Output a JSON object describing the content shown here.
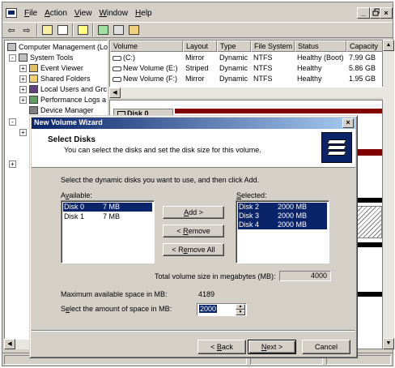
{
  "menu": {
    "items": [
      "File",
      "Action",
      "View",
      "Window",
      "Help"
    ],
    "accel": [
      "F",
      "A",
      "V",
      "W",
      "H"
    ]
  },
  "window_controls": [
    "_",
    "×"
  ],
  "tree": {
    "items": [
      {
        "label": "Computer Management (Lo",
        "expander": ""
      },
      {
        "label": "System Tools",
        "expander": "-"
      },
      {
        "label": "Event Viewer",
        "expander": "+"
      },
      {
        "label": "Shared Folders",
        "expander": "+"
      },
      {
        "label": "Local Users and Grc",
        "expander": "+"
      },
      {
        "label": "Performance Logs a",
        "expander": "+"
      },
      {
        "label": "Device Manager",
        "expander": ""
      }
    ]
  },
  "volumes": {
    "columns": [
      "Volume",
      "Layout",
      "Type",
      "File System",
      "Status",
      "Capacity"
    ],
    "rows": [
      [
        "(C:)",
        "Mirror",
        "Dynamic",
        "NTFS",
        "Healthy (Boot)",
        "7.99 GB"
      ],
      [
        "New Volume (E:)",
        "Striped",
        "Dynamic",
        "NTFS",
        "Healthy",
        "5.86 GB"
      ],
      [
        "New Volume (F:)",
        "Mirror",
        "Dynamic",
        "NTFS",
        "Healthy",
        "1.95 GB"
      ]
    ]
  },
  "disk_label_partial": "Disk 0",
  "dialog": {
    "title": "New Volume Wizard",
    "close": "×",
    "header_title": "Select Disks",
    "header_subtitle": "You can select the disks and set the disk size for this volume.",
    "instruction": "Select the dynamic disks you want to use, and then click Add.",
    "available_label": "Available:",
    "available_accel": "v",
    "selected_label": "Selected:",
    "selected_accel": "S",
    "available": [
      {
        "disk": "Disk 0",
        "size": "7 MB",
        "selected": true
      },
      {
        "disk": "Disk 1",
        "size": "7 MB",
        "selected": false
      }
    ],
    "selected": [
      {
        "disk": "Disk 2",
        "size": "2000 MB"
      },
      {
        "disk": "Disk 3",
        "size": "2000 MB"
      },
      {
        "disk": "Disk 4",
        "size": "2000 MB"
      }
    ],
    "add_button": "Add >",
    "remove_button": "< Remove",
    "remove_all_button": "< Remove All",
    "total_label": "Total volume size in megabytes (MB):",
    "total_value": "4000",
    "max_label": "Maximum available space in MB:",
    "max_value": "4189",
    "amount_label": "Select the amount of space in MB:",
    "amount_value": "2000",
    "back_button": "< Back",
    "next_button": "Next >",
    "cancel_button": "Cancel"
  },
  "colors": {
    "title_start": "#0a246a",
    "title_end": "#a6caf0",
    "selection": "#0a246a",
    "disk_bar": "#800000"
  },
  "icons": [
    "back-arrow-icon",
    "forward-arrow-icon",
    "up-folder-icon",
    "show-hide-tree-icon",
    "help-icon",
    "refresh-icon",
    "properties-icon",
    "export-icon"
  ]
}
